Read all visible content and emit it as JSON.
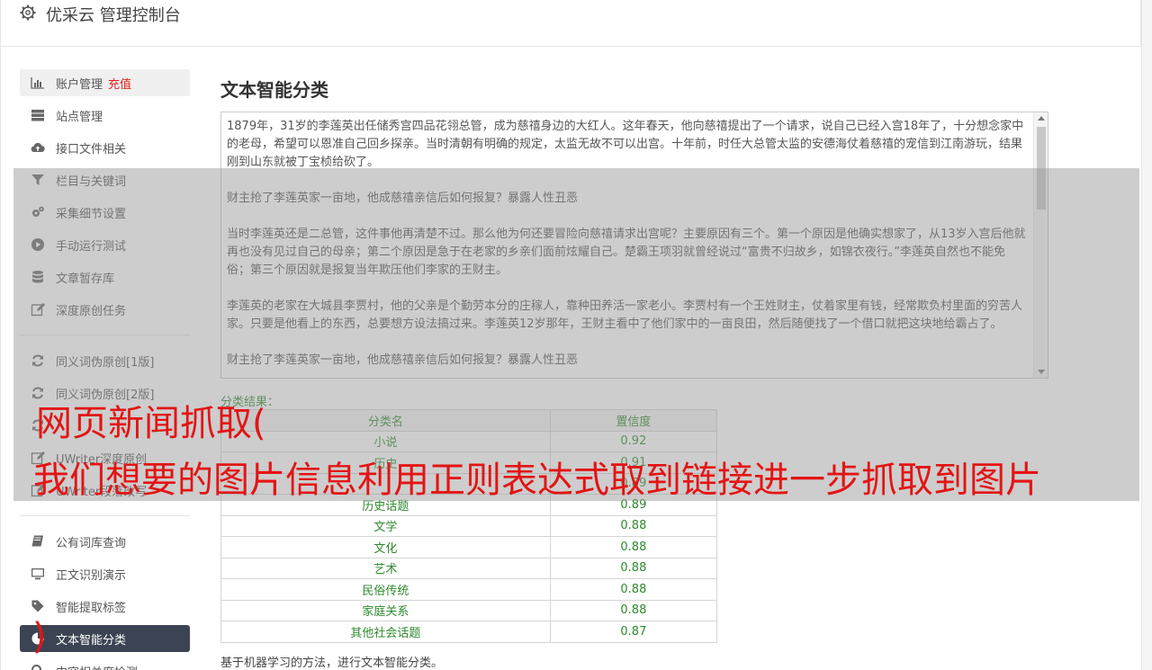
{
  "app": {
    "title": "优采云 管理控制台"
  },
  "sidebar": {
    "items": [
      {
        "label": "账户管理",
        "badge": "充值",
        "icon": "bar-chart-icon"
      },
      {
        "label": "站点管理",
        "icon": "server-icon"
      },
      {
        "label": "接口文件相关",
        "icon": "cloud-upload-icon"
      },
      {
        "label": "栏目与关键词",
        "icon": "filter-icon"
      },
      {
        "label": "采集细节设置",
        "icon": "gears-icon"
      },
      {
        "label": "手动运行测试",
        "icon": "play-circle-icon"
      },
      {
        "label": "文章暂存库",
        "icon": "database-icon"
      },
      {
        "label": "深度原创任务",
        "icon": "edit-icon"
      },
      {
        "label": "同义词伪原创[1版]",
        "icon": "refresh-icon"
      },
      {
        "label": "同义词伪原创[2版]",
        "icon": "refresh-icon"
      },
      {
        "label": "",
        "icon": "refresh-icon"
      },
      {
        "label": "UWriter深度原创",
        "icon": "edit-icon"
      },
      {
        "label": "UWriter段落改写",
        "icon": "edit-icon"
      },
      {
        "label": "公有词库查询",
        "icon": "book-icon"
      },
      {
        "label": "正文识别演示",
        "icon": "desktop-icon"
      },
      {
        "label": "智能提取标签",
        "icon": "tag-icon"
      },
      {
        "label": "文本智能分类",
        "icon": "pie-chart-icon"
      },
      {
        "label": "内容相关度检测",
        "icon": "search-icon"
      }
    ]
  },
  "main": {
    "title": "文本智能分类",
    "paragraphs": [
      "1879年，31岁的李莲英出任储秀宫四品花翎总管，成为慈禧身边的大红人。这年春天，他向慈禧提出了一个请求，说自己已经入宫18年了，十分想念家中的老母，希望可以恩准自己回乡探亲。当时清朝有明确的规定，太监无故不可以出宫。十年前，时任大总管太监的安德海仗着慈禧的宠信到江南游玩，结果刚到山东就被丁宝桢给砍了。",
      "财主抢了李莲英家一亩地，他成慈禧亲信后如何报复？暴露人性丑恶",
      "当时李莲英还是二总管，这件事他再清楚不过。那么他为何还要冒险向慈禧请求出宫呢？主要原因有三个。第一个原因是他确实想家了，从13岁入宫后他就再也没有见过自己的母亲；第二个原因是急于在老家的乡亲们面前炫耀自己。楚霸王项羽就曾经说过“富贵不归故乡，如锦衣夜行。”李莲英自然也不能免俗；第三个原因就是报复当年欺压他们李家的王财主。",
      "李莲英的老家在大城县李贾村，他的父亲是个勤劳本分的庄稼人，靠种田养活一家老小。李贾村有一个王姓财主，仗着家里有钱，经常欺负村里面的穷苦人家。只要是他看上的东西，总要想方设法搞过来。李莲英12岁那年，王财主看中了他们家中的一亩良田，然后随便找了一个借口就把这块地给霸占了。",
      "财主抢了李莲英家一亩地，他成慈禧亲信后如何报复？暴露人性丑恶"
    ],
    "result_label": "分类结果：",
    "table": {
      "headers": [
        "分类名",
        "置信度"
      ],
      "rows": [
        [
          "小说",
          "0.92"
        ],
        [
          "历史",
          "0.91"
        ],
        [
          "",
          "0.89"
        ],
        [
          "历史话题",
          "0.89"
        ],
        [
          "文学",
          "0.88"
        ],
        [
          "文化",
          "0.88"
        ],
        [
          "艺术",
          "0.88"
        ],
        [
          "民俗传统",
          "0.88"
        ],
        [
          "家庭关系",
          "0.88"
        ],
        [
          "其他社会话题",
          "0.87"
        ]
      ]
    },
    "footnote": "基于机器学习的方法，进行文本智能分类。"
  },
  "watermark": {
    "line1": "网页新闻抓取(",
    "line2": "我们想要的图片信息利用正则表达式取到链接进一步抓取到图片",
    "line3": ")"
  },
  "colors": {
    "accent_red": "#e02020",
    "result_green": "#2d8a2d",
    "active_nav": "#3c4454",
    "watermark_red": "#e41414"
  }
}
